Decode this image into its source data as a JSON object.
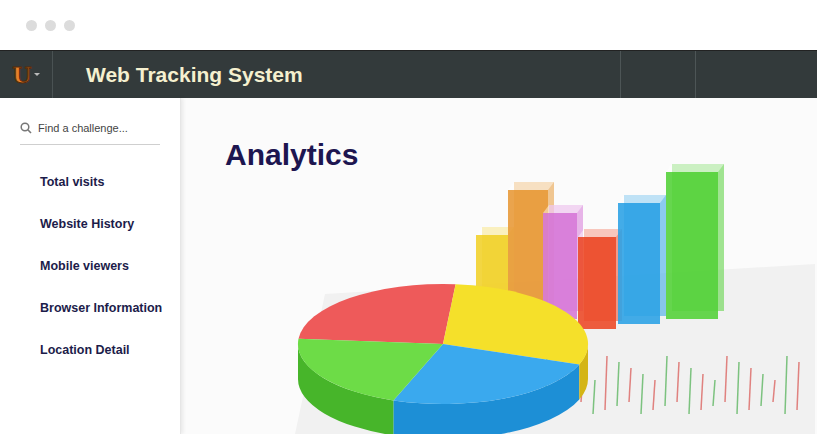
{
  "header": {
    "logo": "U",
    "title": "Web Tracking System"
  },
  "search": {
    "placeholder": "Find a challenge..."
  },
  "sidebar": {
    "items": [
      {
        "label": "Total visits",
        "selected": false
      },
      {
        "label": "Website History",
        "selected": false
      },
      {
        "label": "Mobile viewers",
        "selected": false
      },
      {
        "label": "Browser Information",
        "selected": false
      },
      {
        "label": "Location Detail",
        "selected": false
      }
    ]
  },
  "main": {
    "heading": "Analytics"
  }
}
